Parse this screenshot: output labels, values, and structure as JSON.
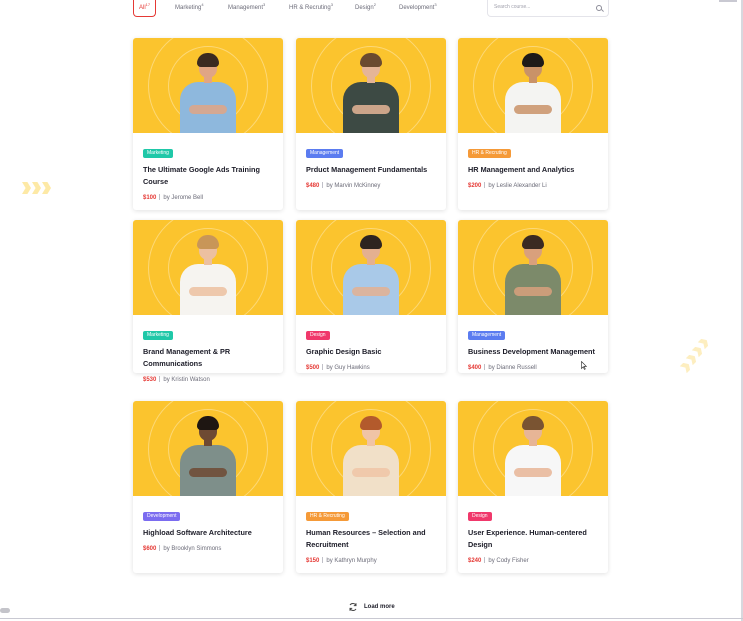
{
  "filters": {
    "tabs": [
      {
        "label": "All",
        "count": "17",
        "active": true
      },
      {
        "label": "Marketing",
        "count": "4",
        "active": false
      },
      {
        "label": "Management",
        "count": "3",
        "active": false
      },
      {
        "label": "HR & Recruting",
        "count": "3",
        "active": false
      },
      {
        "label": "Design",
        "count": "2",
        "active": false
      },
      {
        "label": "Development",
        "count": "3",
        "active": false
      }
    ],
    "search_placeholder": "Search course..."
  },
  "courses": [
    {
      "tag": "Marketing",
      "tag_color": "#1fc8a8",
      "title": "The Ultimate Google Ads Training Course",
      "price": "$100",
      "author": "by Jerome Bell",
      "shirt_color": "#8eb8dd",
      "hair_color": "#3b2a20",
      "skin": "#e0a585"
    },
    {
      "tag": "Management",
      "tag_color": "#5b7cf0",
      "title": "Prduct Management Fundamentals",
      "price": "$480",
      "author": "by Marvin McKinney",
      "shirt_color": "#3d4a44",
      "hair_color": "#6b4a2f",
      "skin": "#e5b597"
    },
    {
      "tag": "HR & Recruting",
      "tag_color": "#f59a38",
      "title": "HR  Management and Analytics",
      "price": "$200",
      "author": "by Leslie Alexander Li",
      "shirt_color": "#f4f4f2",
      "hair_color": "#1e1a18",
      "skin": "#c99268"
    },
    {
      "tag": "Marketing",
      "tag_color": "#1fc8a8",
      "title": "Brand Management & PR Communications",
      "price": "$530",
      "author": "by Kristin Watson",
      "shirt_color": "#f6f4f0",
      "hair_color": "#c89658",
      "skin": "#ecc0a0"
    },
    {
      "tag": "Design",
      "tag_color": "#f0386b",
      "title": "Graphic Design Basic",
      "price": "$500",
      "author": "by Guy Hawkins",
      "shirt_color": "#a9c9e8",
      "hair_color": "#2e2420",
      "skin": "#e4b090"
    },
    {
      "tag": "Management",
      "tag_color": "#5b7cf0",
      "title": "Business Development Management",
      "price": "$400",
      "author": "by Dianne Russell",
      "shirt_color": "#7c8a6a",
      "hair_color": "#3a2a22",
      "skin": "#d9a07c"
    },
    {
      "tag": "Development",
      "tag_color": "#7b6cf0",
      "title": "Highload Software Architecture",
      "price": "$600",
      "author": "by Brooklyn Simmons",
      "shirt_color": "#7e8f8a",
      "hair_color": "#1e1612",
      "skin": "#6e4a33"
    },
    {
      "tag": "HR & Recruting",
      "tag_color": "#f59a38",
      "title": "Human Resources – Selection and Recruitment",
      "price": "$150",
      "author": "by Kathryn Murphy",
      "shirt_color": "#f1e0c8",
      "hair_color": "#b35a2c",
      "skin": "#f0c4a6"
    },
    {
      "tag": "Design",
      "tag_color": "#f0386b",
      "title": "User Experience. Human-centered Design",
      "price": "$240",
      "author": "by Cody Fisher",
      "shirt_color": "#f7f7f7",
      "hair_color": "#7a5432",
      "skin": "#e7b596"
    }
  ],
  "load_more": {
    "label": "Load more"
  },
  "colors": {
    "accent": "#e53935",
    "thumb_bg": "#fbc42e"
  }
}
